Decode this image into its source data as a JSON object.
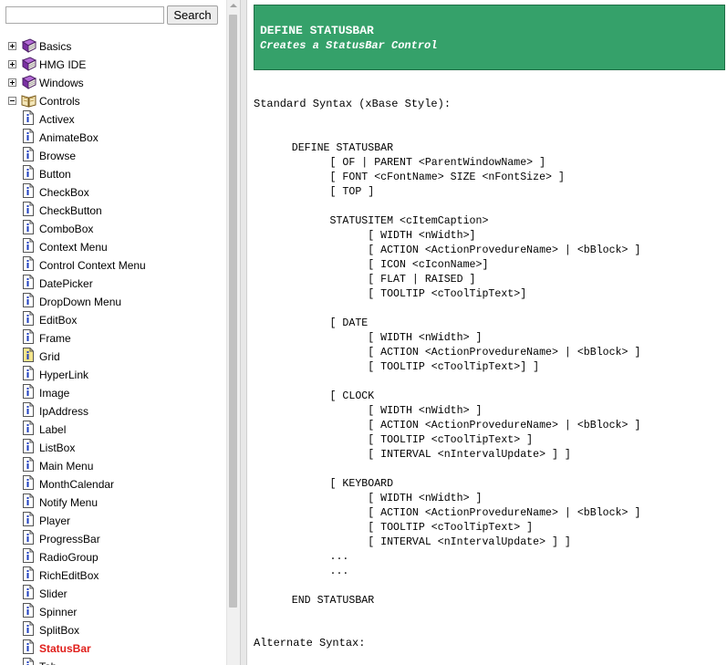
{
  "search": {
    "placeholder": "",
    "value": "",
    "button_label": "Search"
  },
  "tree": {
    "top_items": [
      {
        "label": "Basics",
        "state": "collapsed"
      },
      {
        "label": "HMG IDE",
        "state": "collapsed"
      },
      {
        "label": "Windows",
        "state": "collapsed"
      },
      {
        "label": "Controls",
        "state": "expanded"
      }
    ],
    "controls_children": [
      "Activex",
      "AnimateBox",
      "Browse",
      "Button",
      "CheckBox",
      "CheckButton",
      "ComboBox",
      "Context Menu",
      "Control Context Menu",
      "DatePicker",
      "DropDown Menu",
      "EditBox",
      "Frame",
      "Grid",
      "HyperLink",
      "Image",
      "IpAddress",
      "Label",
      "ListBox",
      "Main Menu",
      "MonthCalendar",
      "Notify Menu",
      "Player",
      "ProgressBar",
      "RadioGroup",
      "RichEditBox",
      "Slider",
      "Spinner",
      "SplitBox",
      "StatusBar",
      "Tab"
    ],
    "selected": "StatusBar"
  },
  "content": {
    "title": "DEFINE STATUSBAR",
    "subtitle": "Creates a StatusBar Control",
    "standard_heading": "Standard Syntax (xBase Style):",
    "syntax_lines": [
      "      DEFINE STATUSBAR",
      "            [ OF | PARENT <ParentWindowName> ]",
      "            [ FONT <cFontName> SIZE <nFontSize> ]",
      "            [ TOP ]",
      "",
      "            STATUSITEM <cItemCaption>",
      "                  [ WIDTH <nWidth>]",
      "                  [ ACTION <ActionProvedureName> | <bBlock> ]",
      "                  [ ICON <cIconName>]",
      "                  [ FLAT | RAISED ]",
      "                  [ TOOLTIP <cToolTipText>]",
      "",
      "            [ DATE",
      "                  [ WIDTH <nWidth> ]",
      "                  [ ACTION <ActionProvedureName> | <bBlock> ]",
      "                  [ TOOLTIP <cToolTipText>] ]",
      "",
      "            [ CLOCK",
      "                  [ WIDTH <nWidth> ]",
      "                  [ ACTION <ActionProvedureName> | <bBlock> ]",
      "                  [ TOOLTIP <cToolTipText> ]",
      "                  [ INTERVAL <nIntervalUpdate> ] ]",
      "",
      "            [ KEYBOARD",
      "                  [ WIDTH <nWidth> ]",
      "                  [ ACTION <ActionProvedureName> | <bBlock> ]",
      "                  [ TOOLTIP <cToolTipText> ]",
      "                  [ INTERVAL <nIntervalUpdate> ] ]",
      "            ...",
      "            ...",
      "",
      "      END STATUSBAR"
    ],
    "alternate_heading": "Alternate Syntax:"
  },
  "colors": {
    "header_bg": "#35a16a",
    "selected_text": "#e0201c"
  }
}
